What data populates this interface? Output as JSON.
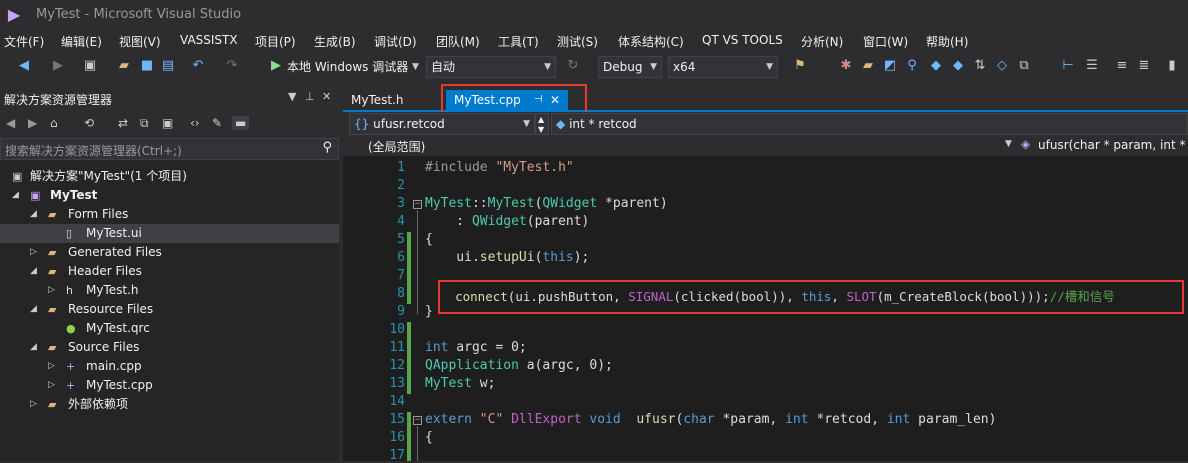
{
  "window": {
    "title": "MyTest - Microsoft Visual Studio"
  },
  "menu": [
    "文件(F)",
    "编辑(E)",
    "视图(V)",
    "VASSISTX",
    "项目(P)",
    "生成(B)",
    "调试(D)",
    "团队(M)",
    "工具(T)",
    "测试(S)",
    "体系结构(C)",
    "QT VS TOOLS",
    "分析(N)",
    "窗口(W)",
    "帮助(H)"
  ],
  "toolbar": {
    "debugger": "本地 Windows 调试器",
    "solution_config_value": "自动",
    "config": "Debug",
    "platform": "x64"
  },
  "solution_explorer": {
    "title": "解决方案资源管理器",
    "search_placeholder": "搜索解决方案资源管理器(Ctrl+;)",
    "items": [
      {
        "label": "解决方案\"MyTest\"(1 个项目)"
      },
      {
        "label": "MyTest"
      },
      {
        "label": "Form Files"
      },
      {
        "label": "MyTest.ui"
      },
      {
        "label": "Generated Files"
      },
      {
        "label": "Header Files"
      },
      {
        "label": "MyTest.h"
      },
      {
        "label": "Resource Files"
      },
      {
        "label": "MyTest.qrc"
      },
      {
        "label": "Source Files"
      },
      {
        "label": "main.cpp"
      },
      {
        "label": "MyTest.cpp"
      },
      {
        "label": "外部依赖项"
      }
    ]
  },
  "tabs": [
    {
      "label": "MyTest.h"
    },
    {
      "label": "MyTest.cpp"
    }
  ],
  "nav": {
    "left_scope": "ufusr.retcod",
    "right_member": "int * retcod",
    "scope": "(全局范围)",
    "function": "ufusr(char * param, int * re"
  },
  "editor": {
    "line_numbers": [
      "1",
      "2",
      "3",
      "4",
      "5",
      "6",
      "7",
      "8",
      "9",
      "10",
      "11",
      "12",
      "13",
      "14",
      "15",
      "16",
      "17"
    ],
    "lines": [
      "#include \"MyTest.h\"",
      "",
      "MyTest::MyTest(QWidget *parent)",
      "    : QWidget(parent)",
      "{",
      "    ui.setupUi(this);",
      "",
      "    connect(ui.pushButton, SIGNAL(clicked(bool)), this, SLOT(m_CreateBlock(bool)));//槽和信号",
      "}",
      "",
      "int argc = 0;",
      "QApplication a(argc, 0);",
      "MyTest w;",
      "",
      "extern \"C\" DllExport void  ufusr(char *param, int *retcod, int param_len)",
      "{",
      ""
    ]
  },
  "colors": {
    "accent": "#007acc",
    "highlight_box": "#e53935",
    "change_bar": "#57a64a"
  }
}
